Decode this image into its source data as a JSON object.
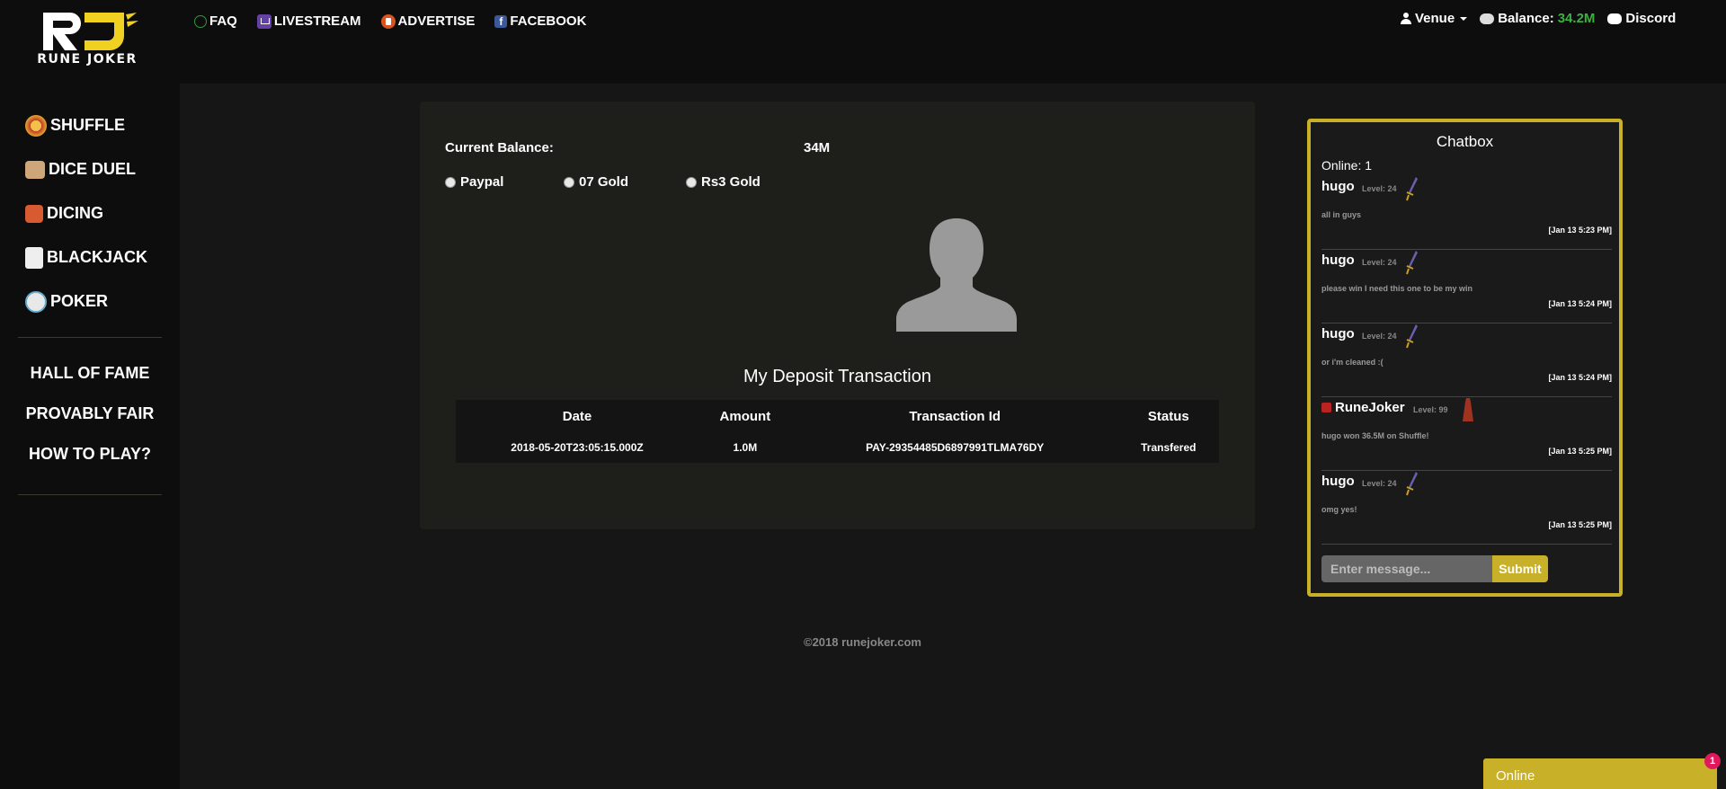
{
  "brand": {
    "name": "RUNE JOKER",
    "colors": {
      "accent": "#c9b029",
      "balance": "#3cb043"
    }
  },
  "topnav": [
    {
      "label": "FAQ",
      "icon": "faq-icon"
    },
    {
      "label": "LIVESTREAM",
      "icon": "twitch-icon"
    },
    {
      "label": "ADVERTISE",
      "icon": "advertise-icon"
    },
    {
      "label": "FACEBOOK",
      "icon": "facebook-icon"
    }
  ],
  "user": {
    "name": "Venue",
    "balance_label": "Balance:",
    "balance_value": "34.2M",
    "discord_label": "Discord"
  },
  "sidebar": {
    "games": [
      {
        "label": "SHUFFLE",
        "icon": "shuffle-icon"
      },
      {
        "label": "DICE DUEL",
        "icon": "dice-icon"
      },
      {
        "label": "DICING",
        "icon": "dicing-icon"
      },
      {
        "label": "BLACKJACK",
        "icon": "blackjack-icon"
      },
      {
        "label": "POKER",
        "icon": "poker-icon"
      }
    ],
    "links": [
      {
        "label": "HALL OF FAME"
      },
      {
        "label": "PROVABLY FAIR"
      },
      {
        "label": "HOW TO PLAY?"
      }
    ]
  },
  "main": {
    "balance_label": "Current Balance:",
    "balance_value": "34M",
    "payment_options": [
      "Paypal",
      "07 Gold",
      "Rs3 Gold"
    ],
    "deposit_title": "My Deposit Transaction",
    "table": {
      "headers": [
        "Date",
        "Amount",
        "Transaction Id",
        "Status"
      ],
      "rows": [
        [
          "2018-05-20T23:05:15.000Z",
          "1.0M",
          "PAY-29354485D6897991TLMA76DY",
          "Transfered"
        ]
      ]
    }
  },
  "footer": {
    "copyright": "©2018 runejoker.com"
  },
  "chatbox": {
    "title": "Chatbox",
    "online": "Online: 1",
    "messages": [
      {
        "user": "hugo",
        "level": "Level: 24",
        "text": "all in guys",
        "time": "[Jan 13 5:23 PM]"
      },
      {
        "user": "hugo",
        "level": "Level: 24",
        "text": "please win I need this one to be my win",
        "time": "[Jan 13 5:24 PM]"
      },
      {
        "user": "hugo",
        "level": "Level: 24",
        "text": "or i'm cleaned :(",
        "time": "[Jan 13 5:24 PM]"
      },
      {
        "user": "RuneJoker",
        "level": "Level: 99",
        "text": "hugo won 36.5M on Shuffle!",
        "time": "[Jan 13 5:25 PM]"
      },
      {
        "user": "hugo",
        "level": "Level: 24",
        "text": "omg yes!",
        "time": "[Jan 13 5:25 PM]"
      }
    ],
    "input_placeholder": "Enter message...",
    "submit_label": "Submit"
  },
  "online_widget": {
    "label": "Online",
    "badge": "1"
  }
}
